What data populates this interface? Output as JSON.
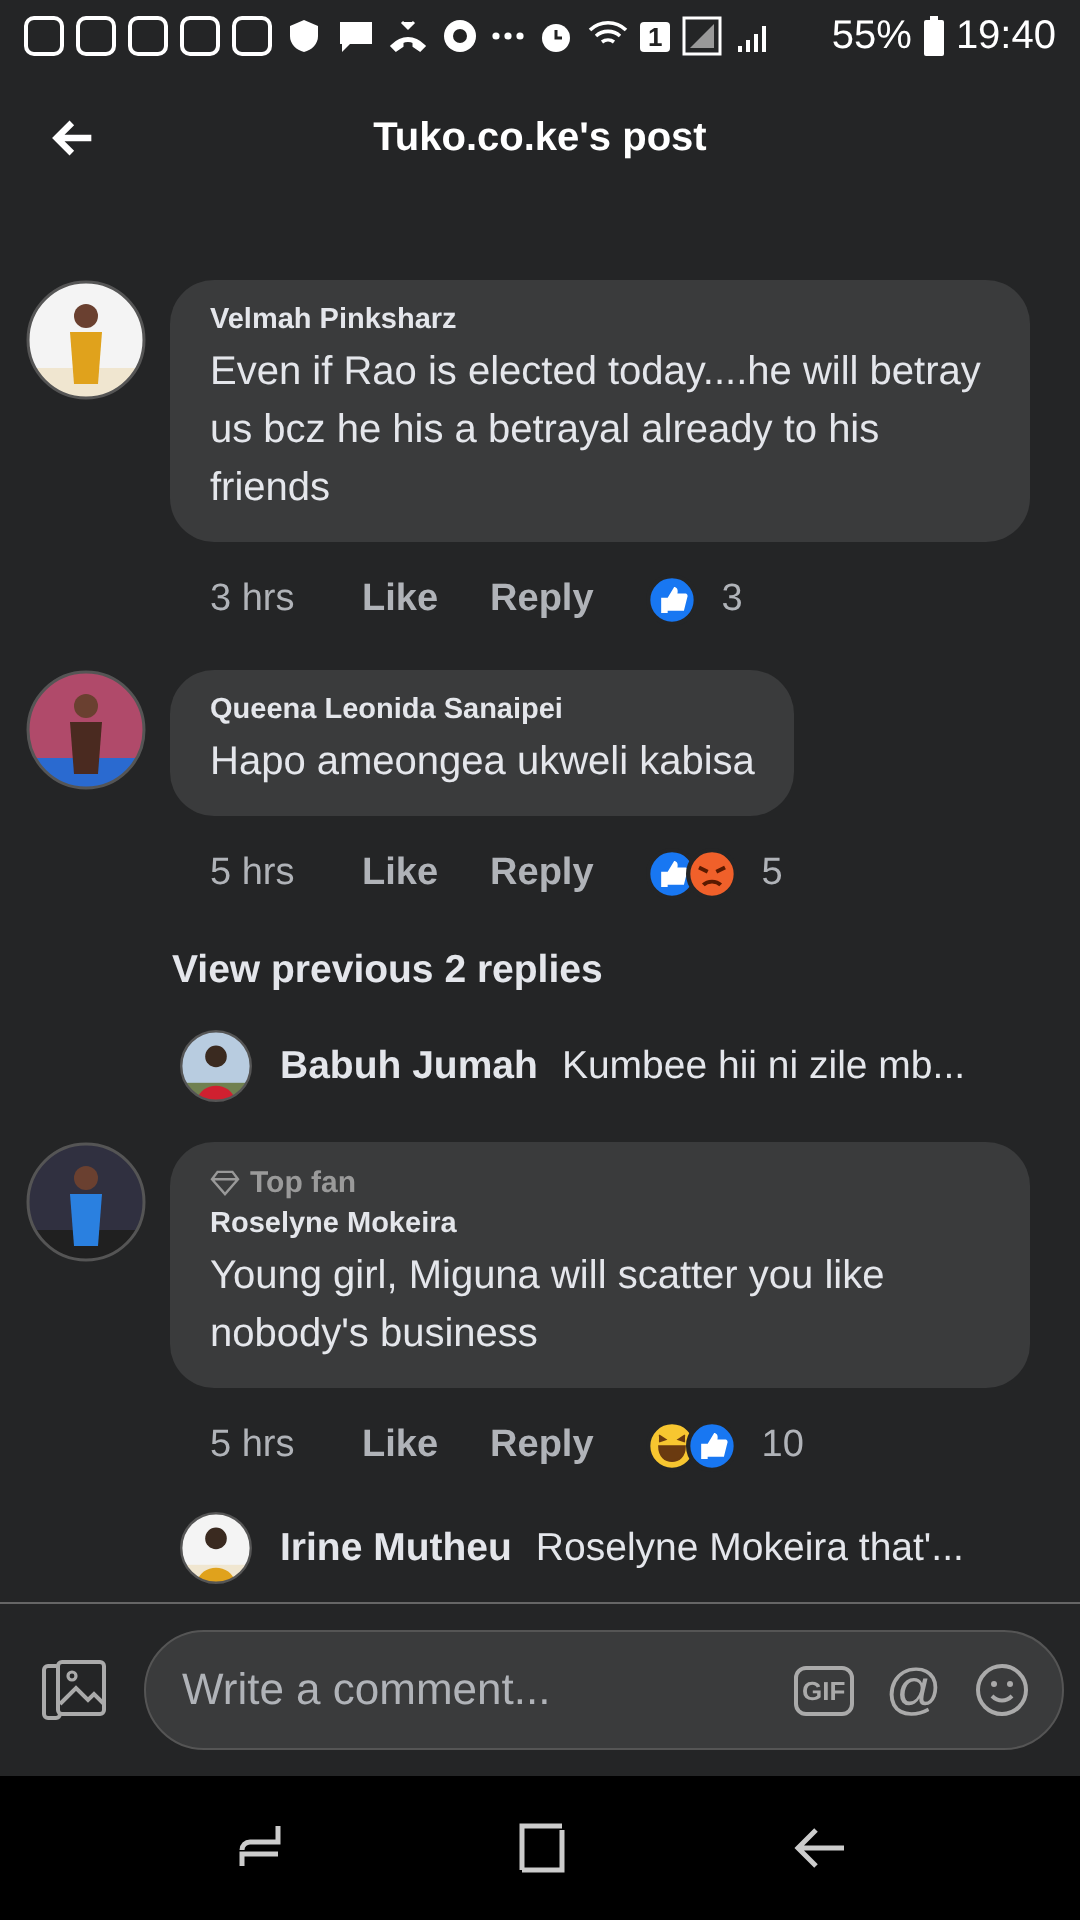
{
  "status_bar": {
    "battery": "55%",
    "time": "19:40",
    "sim": "1"
  },
  "header": {
    "title": "Tuko.co.ke's post"
  },
  "items": [
    {
      "kind": "comment",
      "name": "Velmah Pinksharz",
      "text": "Even if Rao is elected today....he will betray us bcz he his a betrayal already  to his friends",
      "time": "3 hrs",
      "like": "Like",
      "reply": "Reply",
      "reactions": [
        {
          "kind": "like"
        }
      ],
      "count": "3"
    },
    {
      "kind": "comment",
      "name": "Queena Leonida Sanaipei",
      "text": "Hapo ameongea ukweli kabisa",
      "time": "5 hrs",
      "like": "Like",
      "reply": "Reply",
      "reactions": [
        {
          "kind": "like"
        },
        {
          "kind": "angry"
        }
      ],
      "count": "5"
    },
    {
      "kind": "view_more",
      "text": "View previous 2 replies"
    },
    {
      "kind": "reply_preview",
      "name": "Babuh Jumah",
      "text": "Kumbee hii ni zile mb..."
    },
    {
      "kind": "comment",
      "badge": "Top fan",
      "name": "Roselyne Mokeira",
      "text": "Young girl, Miguna will scatter you like nobody's business",
      "time": "5 hrs",
      "like": "Like",
      "reply": "Reply",
      "reactions": [
        {
          "kind": "haha"
        },
        {
          "kind": "like"
        }
      ],
      "count": "10"
    },
    {
      "kind": "reply_preview",
      "name": "Irine Mutheu",
      "text": "Roselyne Mokeira that'..."
    }
  ],
  "composer": {
    "placeholder": "Write a comment...",
    "gif": "GIF",
    "mention": "@"
  }
}
